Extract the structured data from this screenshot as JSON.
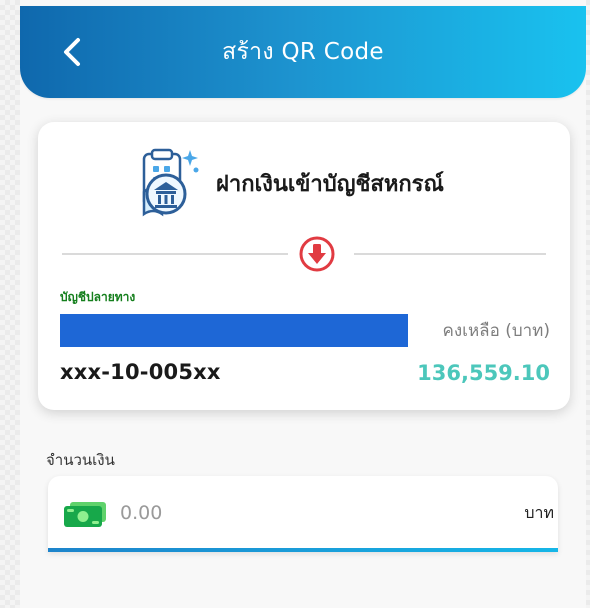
{
  "header": {
    "title": "สร้าง QR Code",
    "back_icon": "chevron-left-icon"
  },
  "account_card": {
    "service_icon": "bank-document-icon",
    "service_title": "ฝากเงินเข้าบัญชีสหกรณ์",
    "transfer_icon": "down-arrow-circle-icon",
    "destination_label": "บัญชีปลายทาง",
    "account_number": "xxx-10-005xx",
    "balance_label": "คงเหลือ (บาท)",
    "balance_value": "136,559.10",
    "account_name_bar_color": "#1e67d6"
  },
  "amount_input": {
    "label": "จำนวนเงิน",
    "placeholder": "0.00",
    "currency": "บาท",
    "money_icon": "money-icon"
  },
  "colors": {
    "header_start": "#0f68ad",
    "header_end": "#19c2ef",
    "destination_green": "#157f1d",
    "balance_teal": "#4cc7bb",
    "transfer_red": "#e13b42",
    "accent_blue": "#1d84cb"
  }
}
